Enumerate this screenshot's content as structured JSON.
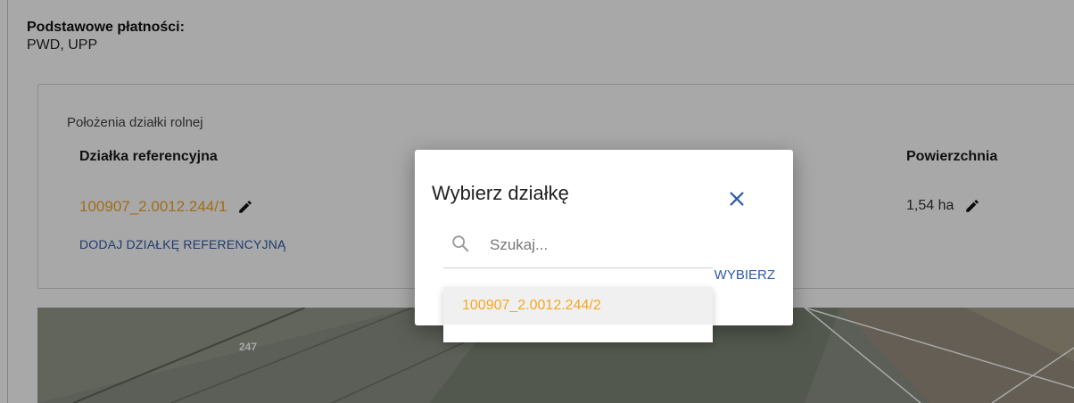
{
  "payments": {
    "label": "Podstawowe płatności:",
    "value": "PWD, UPP"
  },
  "parcel_card": {
    "location_label": "Położenia działki rolnej",
    "ref_header": "Działka referencyjna",
    "area_header": "Powierzchnia",
    "ref_value": "100907_2.0012.244/1",
    "area_value": "1,54 ha",
    "add_link": "DODAJ DZIAŁKĘ REFERENCYJNĄ"
  },
  "map": {
    "parcel_label": "247"
  },
  "dialog": {
    "title": "Wybierz działkę",
    "search_placeholder": "Szukaj...",
    "choose_button": "WYBIERZ",
    "options": [
      "100907_2.0012.244/2"
    ]
  },
  "colors": {
    "accent_orange": "#f5a623",
    "link_blue": "#2f5aa8"
  },
  "icons": [
    "pencil-icon",
    "close-icon",
    "search-icon"
  ]
}
